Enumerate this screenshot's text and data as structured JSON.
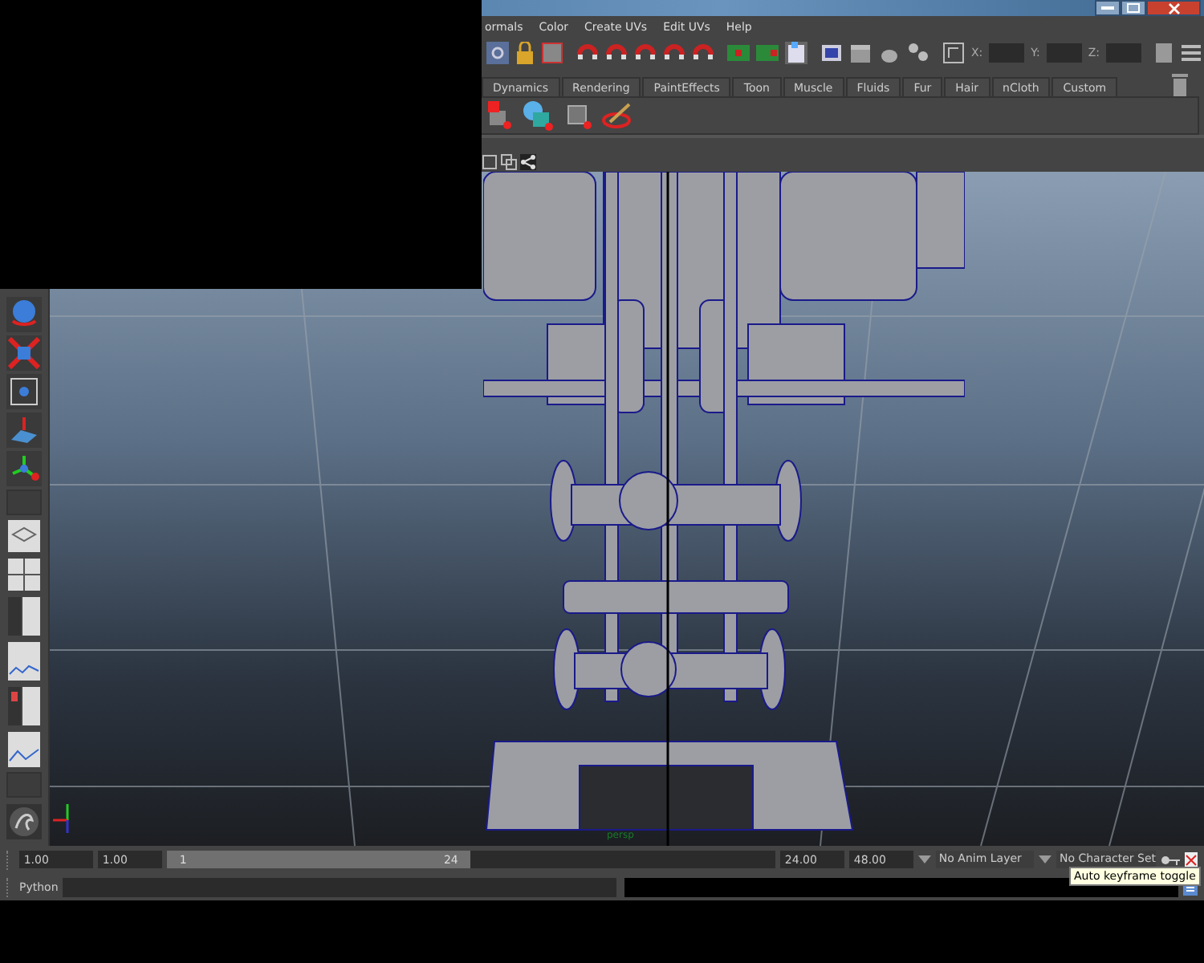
{
  "menu": [
    "ormals",
    "Color",
    "Create UVs",
    "Edit UVs",
    "Help"
  ],
  "coords": [
    {
      "label": "X:"
    },
    {
      "label": "Y:"
    },
    {
      "label": "Z:"
    }
  ],
  "shelf_tabs": [
    {
      "label": "Dynamics",
      "selected": false
    },
    {
      "label": "Rendering",
      "selected": false
    },
    {
      "label": "PaintEffects",
      "selected": false
    },
    {
      "label": "Toon",
      "selected": false
    },
    {
      "label": "Muscle",
      "selected": false
    },
    {
      "label": "Fluids",
      "selected": false
    },
    {
      "label": "Fur",
      "selected": false
    },
    {
      "label": "Hair",
      "selected": false
    },
    {
      "label": "nCloth",
      "selected": false
    },
    {
      "label": "Custom",
      "selected": false
    }
  ],
  "viewport": {
    "camera": "persp"
  },
  "timeline": {
    "start": "1.00",
    "range_start": "1.00",
    "range_slider": {
      "level": 0.5
    },
    "slider_start": "1",
    "slider_end": "24",
    "range_end": "24.00",
    "end": "48.00",
    "anim_layer": "No Anim Layer",
    "character_set": "No Character Set",
    "tooltip": "Auto keyframe toggle"
  },
  "command_line": {
    "label": "Python"
  }
}
